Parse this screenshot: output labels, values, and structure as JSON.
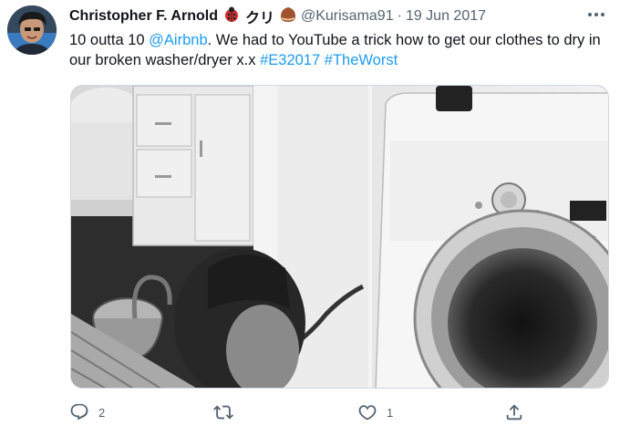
{
  "tweet": {
    "author": {
      "display_name": "Christopher F. Arnold",
      "name_emojis": [
        "ladybug-emoji",
        "kuri-text",
        "chestnut-emoji"
      ],
      "kuri_text": "クリ",
      "handle": "@Kurisama91",
      "date": "19 Jun 2017"
    },
    "separator": "·",
    "text_parts": [
      {
        "text": "10 outta 10 ",
        "type": "plain"
      },
      {
        "text": "@Airbnb",
        "type": "mention"
      },
      {
        "text": ". We had to YouTube a trick how to get our clothes to dry in our broken washer/dryer x.x ",
        "type": "plain"
      },
      {
        "text": "#E32017",
        "type": "hashtag"
      },
      {
        "text": " ",
        "type": "plain"
      },
      {
        "text": "#TheWorst",
        "type": "hashtag"
      }
    ],
    "media": {
      "kind": "photo",
      "description_icon": "photo-washer-dryer"
    },
    "actions": {
      "reply_count": "2",
      "retweet_count": "",
      "like_count": "1"
    }
  },
  "colors": {
    "link": "#1d9bf0",
    "secondary_text": "#536471",
    "primary_text": "#0f1419"
  }
}
